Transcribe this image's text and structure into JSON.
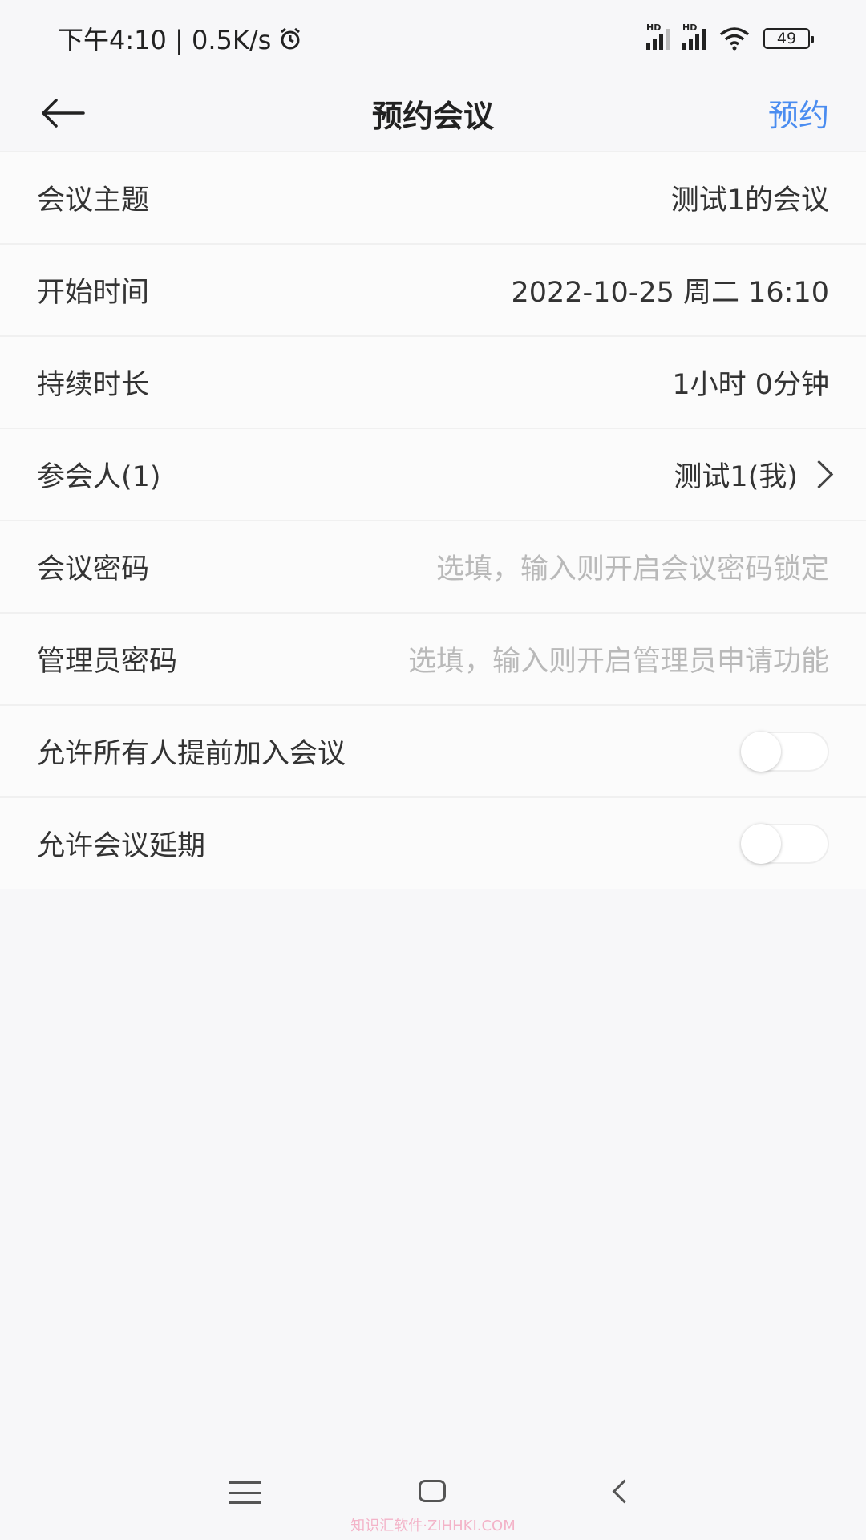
{
  "status_bar": {
    "time_text": "下午4:10 | 0.5K/s",
    "battery": "49",
    "signal_label_1": "HD",
    "signal_label_2": "HD"
  },
  "header": {
    "title": "预约会议",
    "action_label": "预约"
  },
  "form": {
    "rows": [
      {
        "label": "会议主题",
        "value": "测试1的会议"
      },
      {
        "label": "开始时间",
        "value": "2022-10-25 周二 16:10"
      },
      {
        "label": "持续时长",
        "value": "1小时 0分钟"
      },
      {
        "label": "参会人(1)",
        "value": "测试1(我)"
      },
      {
        "label": "会议密码",
        "placeholder": "选填，输入则开启会议密码锁定"
      },
      {
        "label": "管理员密码",
        "placeholder": "选填，输入则开启管理员申请功能"
      },
      {
        "label": "允许所有人提前加入会议",
        "toggle": false
      },
      {
        "label": "允许会议延期",
        "toggle": false
      }
    ]
  },
  "watermark": "知识汇软件·ZIHHKI.COM"
}
